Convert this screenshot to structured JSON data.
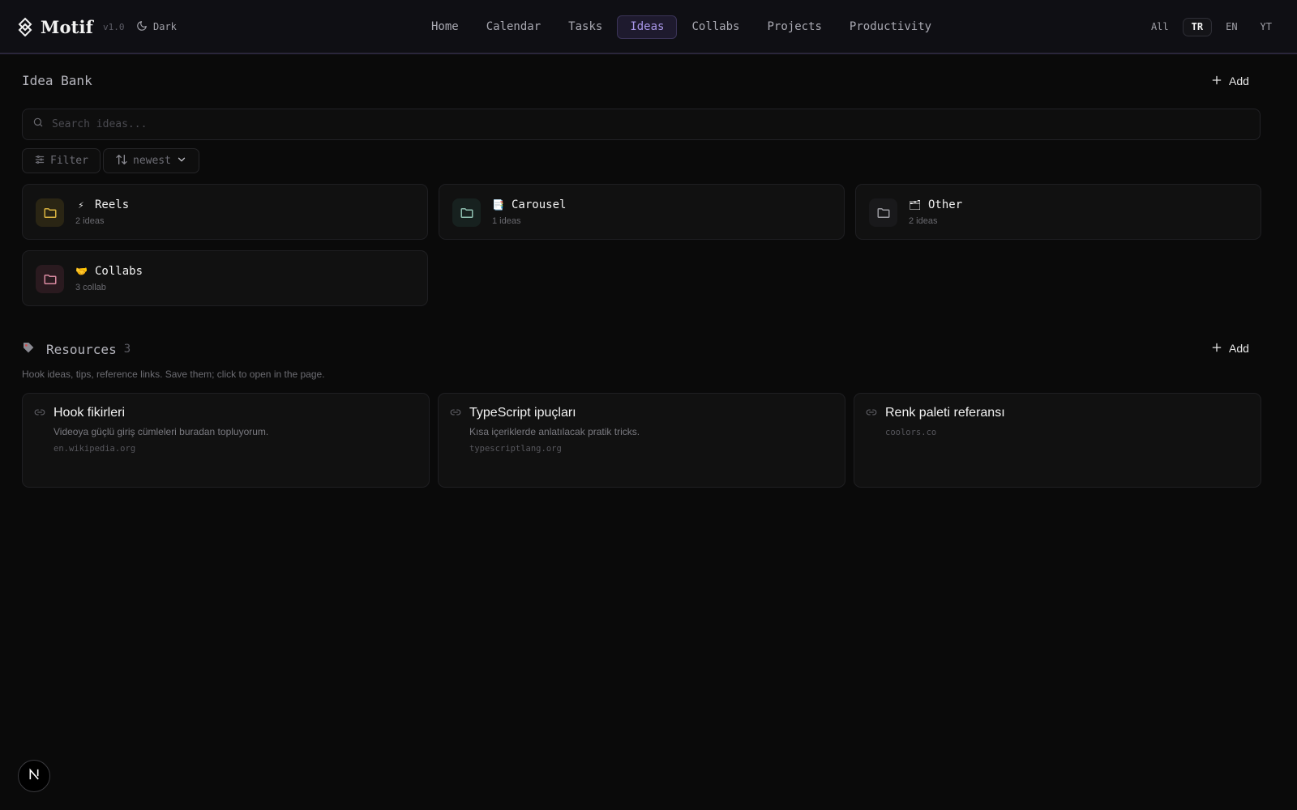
{
  "brand": {
    "name": "Motif",
    "version": "v1.0"
  },
  "theme": {
    "label": "Dark"
  },
  "nav": {
    "items": [
      {
        "label": "Home"
      },
      {
        "label": "Calendar"
      },
      {
        "label": "Tasks"
      },
      {
        "label": "Ideas",
        "active": true
      },
      {
        "label": "Collabs"
      },
      {
        "label": "Projects"
      },
      {
        "label": "Productivity"
      }
    ]
  },
  "lang": {
    "items": [
      {
        "label": "All"
      },
      {
        "label": "TR",
        "active": true
      },
      {
        "label": "EN"
      },
      {
        "label": "YT"
      }
    ]
  },
  "idea_bank": {
    "title": "Idea Bank",
    "add_label": "Add",
    "search_placeholder": "Search ideas...",
    "filter_label": "Filter",
    "sort_label": "newest",
    "folders": [
      {
        "name": "Reels",
        "emoji": "⚡",
        "count": "2 ideas",
        "color": "#d9b341"
      },
      {
        "name": "Carousel",
        "emoji": "📑",
        "count": "1 ideas",
        "color": "#8fbfb0"
      },
      {
        "name": "Other",
        "emoji": "🗂",
        "count": "2 ideas",
        "color": "#9a9aa0"
      },
      {
        "name": "Collabs",
        "emoji": "🤝",
        "count": "3 collab",
        "color": "#d98aa0"
      }
    ]
  },
  "resources": {
    "title": "Resources",
    "count": "3",
    "add_label": "Add",
    "description": "Hook ideas, tips, reference links. Save them; click to open in the page.",
    "items": [
      {
        "title": "Hook fikirleri",
        "description": "Videoya güçlü giriş cümleleri buradan topluyorum.",
        "url": "en.wikipedia.org"
      },
      {
        "title": "TypeScript ipuçları",
        "description": "Kısa içeriklerde anlatılacak pratik tricks.",
        "url": "typescriptlang.org"
      },
      {
        "title": "Renk paleti referansı",
        "description": "",
        "url": "coolors.co"
      }
    ]
  },
  "colors": {
    "accent": "#a896e8",
    "background": "#0a0a0a",
    "card": "#111111"
  },
  "icons": {
    "logo": "motif-logo-icon",
    "theme": "moon-icon",
    "add": "plus-icon",
    "search": "search-icon",
    "filter": "sliders-icon",
    "sort": "sort-arrows-icon",
    "folder": "folder-icon",
    "resources": "tag-icon",
    "link": "link-icon",
    "fab": "next-logo-icon"
  }
}
